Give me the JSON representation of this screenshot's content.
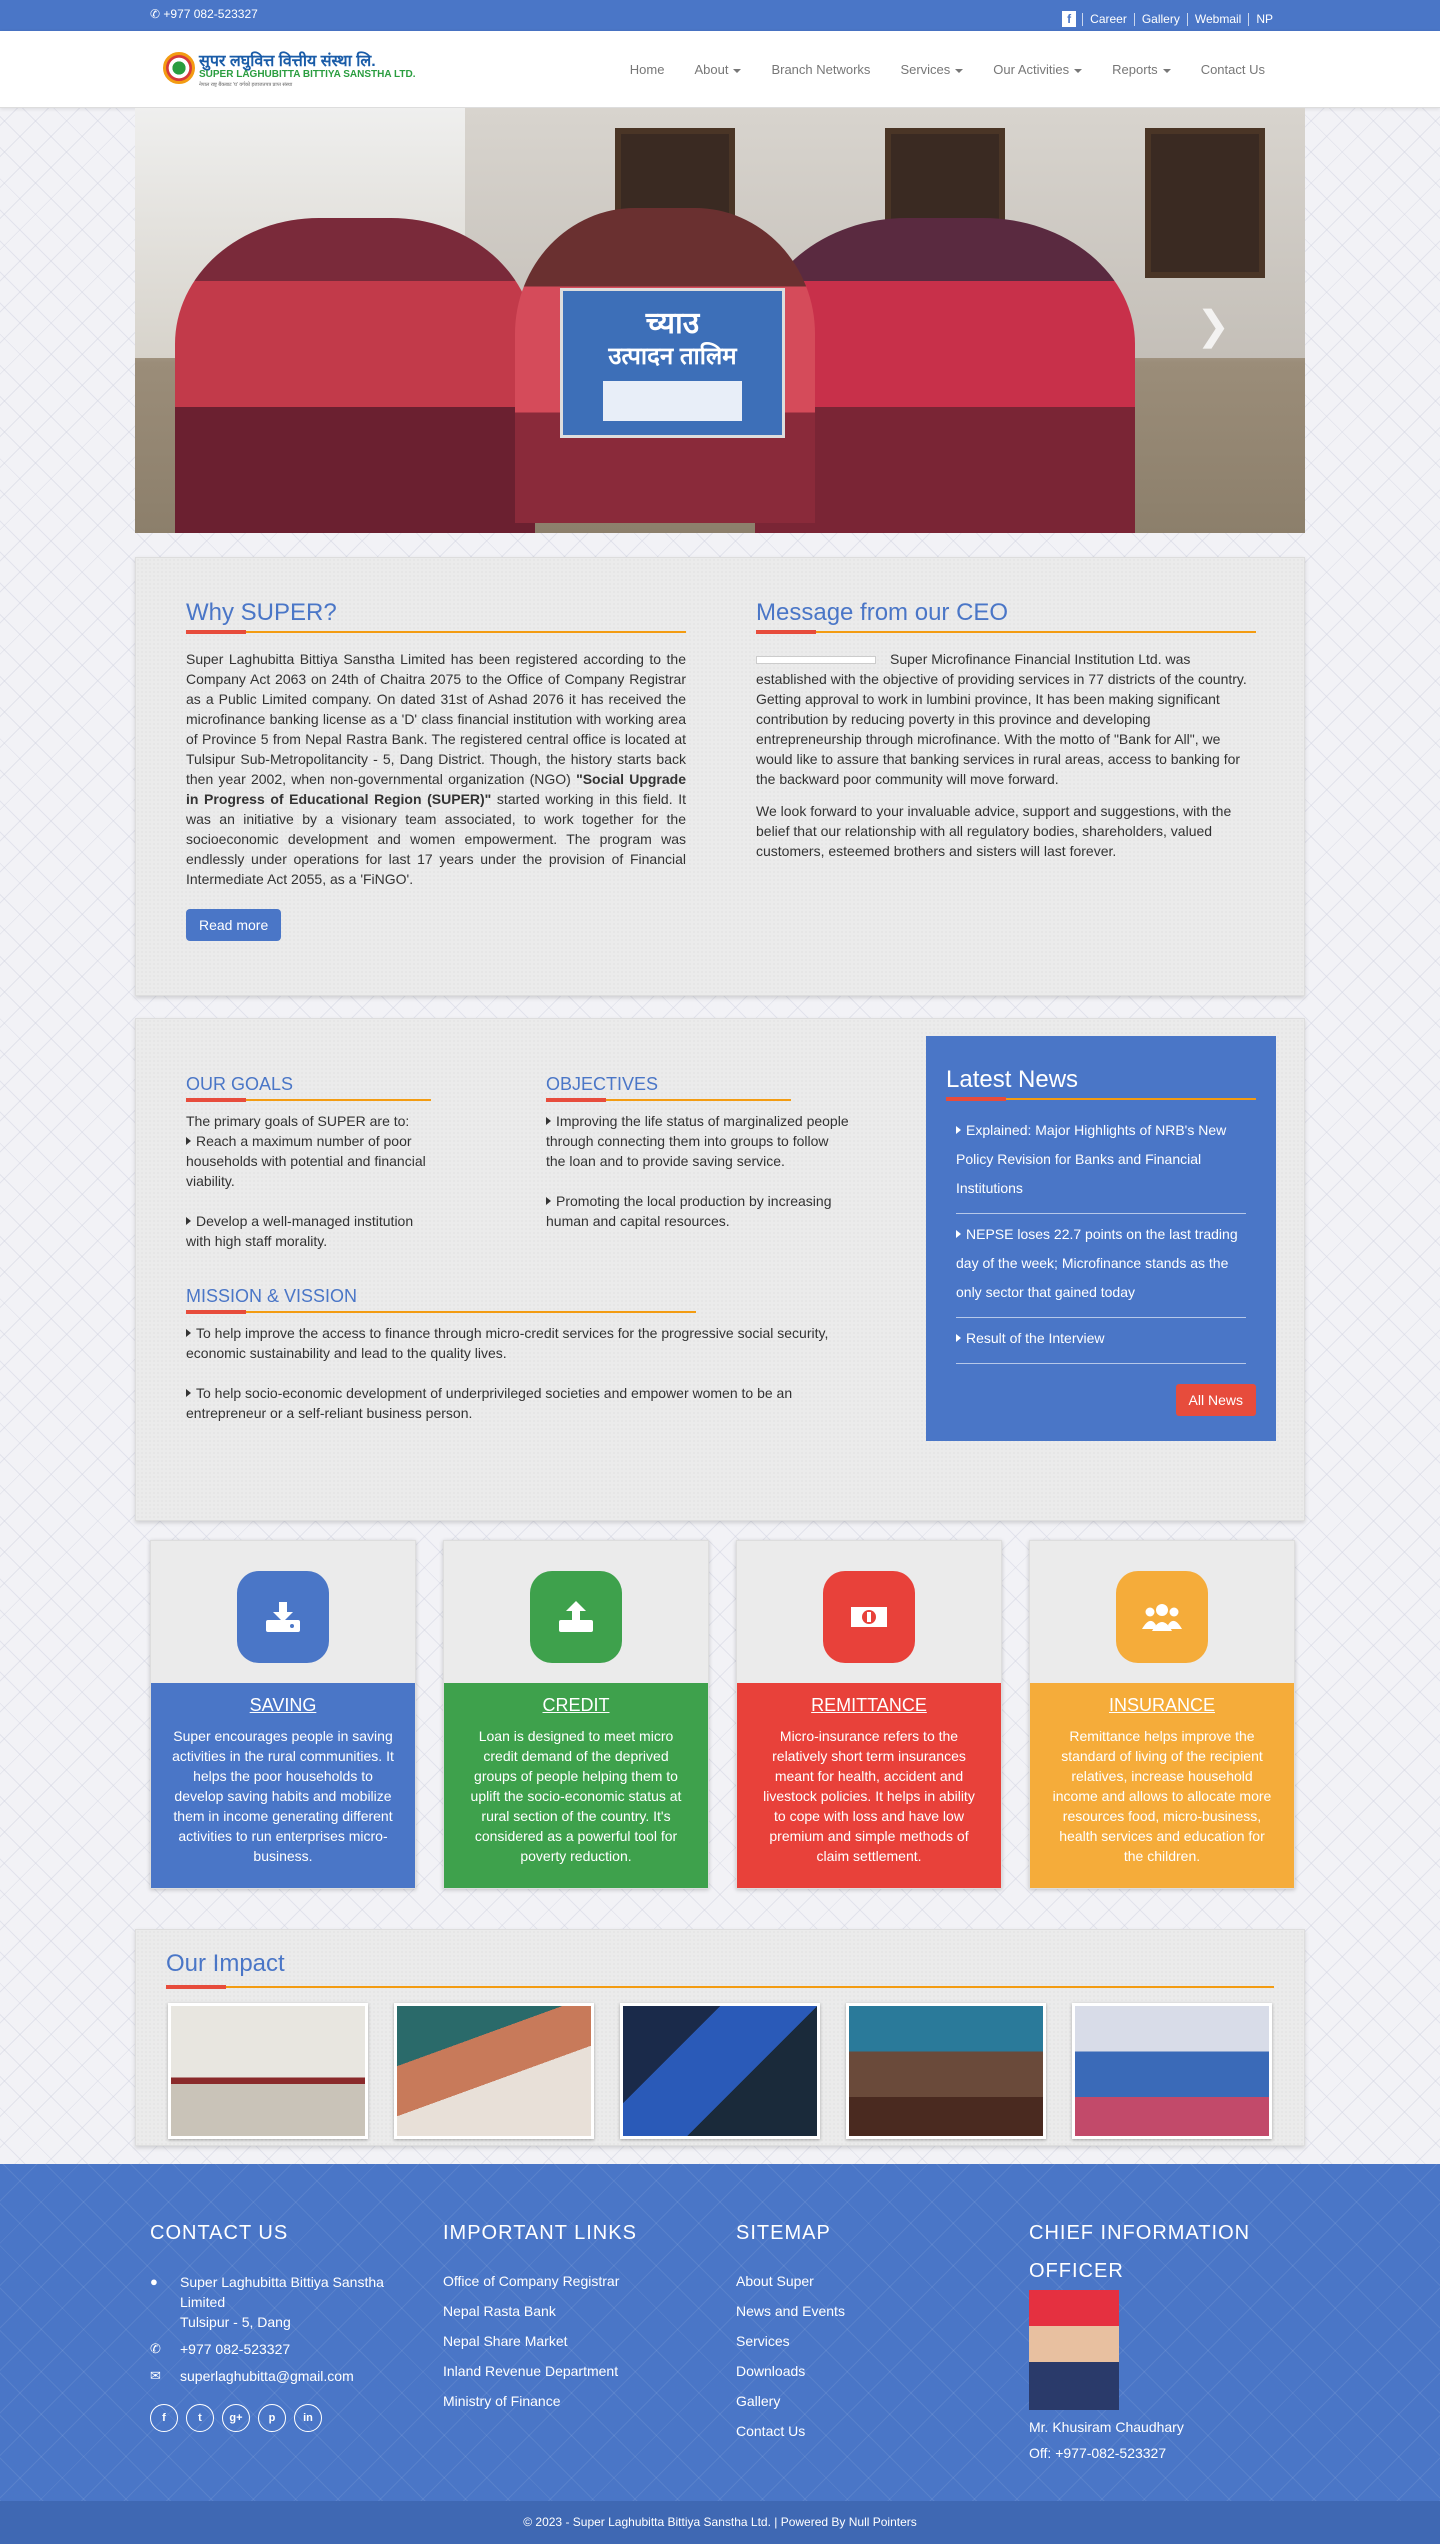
{
  "topbar": {
    "phone": "+977 082-523327",
    "facebook_icon": "f",
    "links": [
      "Career",
      "Gallery",
      "Webmail",
      "NP"
    ]
  },
  "logo": {
    "name_np": "सुपर लघुवित्त वित्तीय संस्था लि.",
    "name_en": "SUPER LAGHUBITTA BITTIYA SANSTHA LTD.",
    "tagline": "नेपाल राष्ट्र बैंकबाट 'घ' वर्गको इजाजतपत्र प्राप्त संस्था"
  },
  "nav": {
    "items": [
      {
        "label": "Home",
        "dropdown": false
      },
      {
        "label": "About",
        "dropdown": true
      },
      {
        "label": "Branch Networks",
        "dropdown": false
      },
      {
        "label": "Services",
        "dropdown": true
      },
      {
        "label": "Our Activities",
        "dropdown": true
      },
      {
        "label": "Reports",
        "dropdown": true
      },
      {
        "label": "Contact Us",
        "dropdown": false
      }
    ]
  },
  "slider": {
    "banner_line1": "च्याउ",
    "banner_line2": "उत्पादन तालिम",
    "next_icon": "chevron-right-icon"
  },
  "why": {
    "title": "Why SUPER?",
    "text_before": "Super Laghubitta Bittiya Sanstha Limited has been registered according to the Company Act 2063 on 24th of Chaitra 2075 to the Office of Company Registrar as a Public Limited company. On dated 31st of Ashad 2076 it has received the microfinance banking license as a 'D' class financial institution with working area of Province 5 from Nepal Rastra Bank. The registered central office is located at Tulsipur Sub-Metropolitancity - 5, Dang District. Though, the history starts back then year 2002, when non-governmental organization (NGO) ",
    "text_bold": "\"Social Upgrade in Progress of Educational Region (SUPER)\"",
    "text_after": " started working in this field. It was an initiative by a visionary team associated, to work together for the socioeconomic development and women empowerment. The program was endlessly under operations for last 17 years under the provision of Financial Intermediate Act 2055, as a 'FiNGO'.",
    "button": "Read more"
  },
  "ceo": {
    "title": "Message from our CEO",
    "para1": "Super Microfinance Financial Institution Ltd. was established with the objective of providing services in 77 districts of the country. Getting approval to work in lumbini province, It has been making significant contribution by reducing poverty in this province and developing entrepreneurship through microfinance. With the motto of \"Bank for All\", we would like to assure that banking services in rural areas, access to banking for the backward poor community will move forward.",
    "para2": "We look forward to your invaluable advice, support and suggestions, with the belief that our relationship with all regulatory bodies, shareholders, valued customers, esteemed brothers and sisters will last forever."
  },
  "goals": {
    "title": "OUR GOALS",
    "intro": "The primary goals of SUPER are to:",
    "items": [
      "Reach a maximum number of poor households with potential and financial viability.",
      "Develop a well-managed institution with high staff morality."
    ]
  },
  "objectives": {
    "title": "OBJECTIVES",
    "items": [
      "Improving the life status of marginalized people through connecting them into groups to follow the loan and to provide saving service.",
      "Promoting the local production by increasing human and capital resources."
    ]
  },
  "mission": {
    "title": "MISSION & VISSION",
    "items": [
      "To help improve the access to finance through micro-credit services for the progressive social security, economic sustainability and lead to the quality lives.",
      "To help socio-economic development of underprivileged societies and empower women to be an entrepreneur or a self-reliant business person."
    ]
  },
  "news": {
    "title": "Latest News",
    "items": [
      "Explained: Major Highlights of NRB's New Policy Revision for Banks and Financial Institutions",
      "NEPSE loses 22.7 points on the last trading day of the week; Microfinance stands as the only sector that gained today",
      "Result of the Interview"
    ],
    "button": "All News"
  },
  "services": [
    {
      "title": "SAVING",
      "icon": "saving-icon",
      "color": "#4a76c7",
      "text": "Super encourages people in saving activities in the rural communities. It helps the poor households to develop saving habits and mobilize them in income generating different activities to run enterprises micro-business."
    },
    {
      "title": "CREDIT",
      "icon": "credit-icon",
      "color": "#3ea14c",
      "text": "Loan is designed to meet micro credit demand of the deprived groups of people helping them to uplift the socio-economic status at rural section of the country. It's considered as a powerful tool for poverty reduction."
    },
    {
      "title": "REMITTANCE",
      "icon": "remittance-icon",
      "color": "#e8413a",
      "text": "Micro-insurance refers to the relatively short term insurances meant for health, accident and livestock policies. It helps in ability to cope with loss and have low premium and simple methods of claim settlement."
    },
    {
      "title": "INSURANCE",
      "icon": "insurance-icon",
      "color": "#f5ac3a",
      "text": "Remittance helps improve the standard of living of the recipient relatives, increase household income and allows to allocate more resources food, micro-business, health services and education for the children."
    }
  ],
  "impact": {
    "title": "Our Impact",
    "photos": [
      "impact-photo-1",
      "impact-photo-2",
      "impact-photo-3",
      "impact-photo-4",
      "impact-photo-5"
    ]
  },
  "footer": {
    "contact": {
      "title": "CONTACT US",
      "address1": "Super Laghubitta Bittiya Sanstha Limited",
      "address2": "Tulsipur - 5, Dang",
      "phone": "+977 082-523327",
      "email": "superlaghubitta@gmail.com",
      "social": [
        "f",
        "t",
        "g+",
        "p",
        "in"
      ]
    },
    "links": {
      "title": "IMPORTANT LINKS",
      "items": [
        "Office of Company Registrar",
        "Nepal Rasta Bank",
        "Nepal Share Market",
        "Inland Revenue Department",
        "Ministry of Finance"
      ]
    },
    "sitemap": {
      "title": "SITEMAP",
      "items": [
        "About Super",
        "News and Events",
        "Services",
        "Downloads",
        "Gallery",
        "Contact Us"
      ]
    },
    "cio": {
      "title": "CHIEF INFORMATION OFFICER",
      "name": "Mr. Khusiram Chaudhary",
      "phone": "Off: +977-082-523327"
    }
  },
  "copyright": "© 2023 - Super Laghubitta Bittiya Sanstha Ltd. | Powered By Null Pointers"
}
